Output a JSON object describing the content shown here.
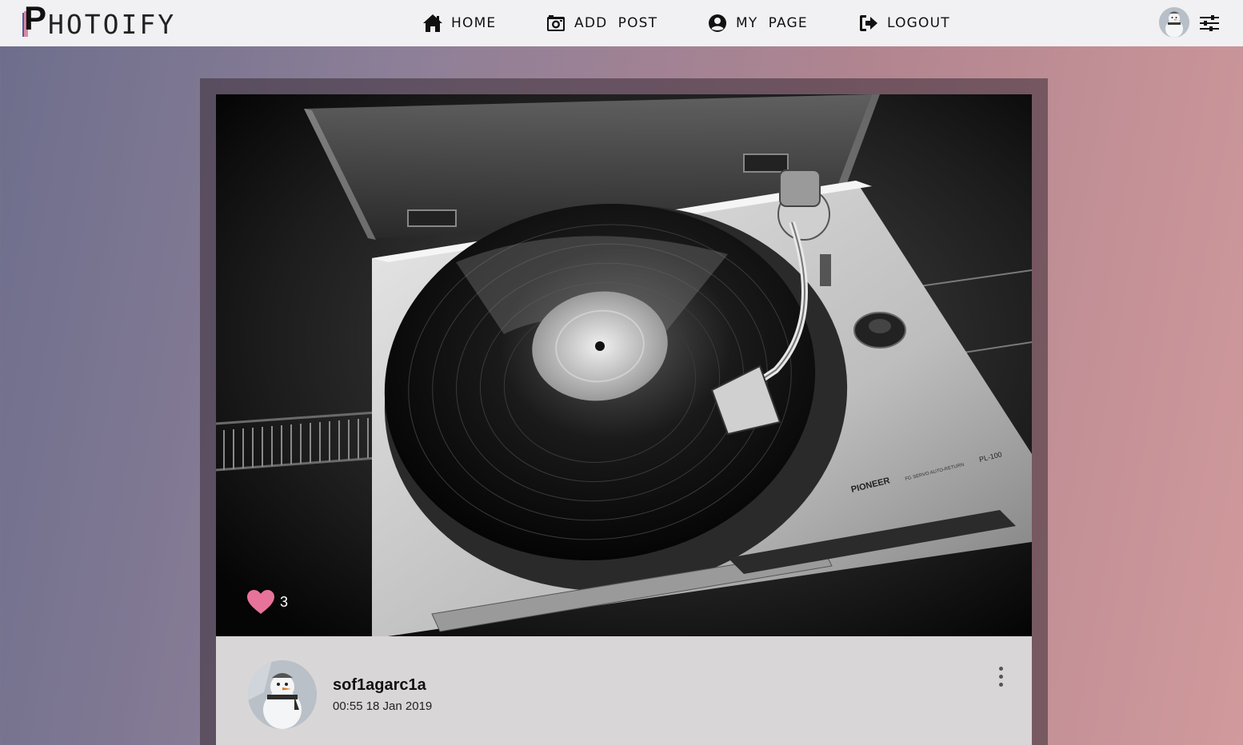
{
  "app": {
    "logo_letter": "P",
    "logo_text": "HOTOIFY"
  },
  "nav": {
    "items": [
      {
        "label": "HOME",
        "icon": "home-icon"
      },
      {
        "label": "ADD  POST",
        "icon": "camera-icon"
      },
      {
        "label": "MY  PAGE",
        "icon": "user-circle-icon"
      },
      {
        "label": "LOGOUT",
        "icon": "sign-out-icon"
      }
    ],
    "avatar_icon": "snowman-avatar",
    "settings_icon": "sliders-icon"
  },
  "post": {
    "image_icon": "turntable-photo",
    "likes": "3",
    "like_color": "#e8739a",
    "author": "sof1agarc1a",
    "timestamp": "00:55 18 Jan 2019",
    "menu_icon": "more-vertical-icon",
    "turntable_label": "PIONEER",
    "turntable_model": "PL-100",
    "turntable_caption": "FG SERVO  AUTO-RETURN"
  },
  "colors": {
    "nav_bg": "#f1f0f2",
    "footer_bg": "#d9d6d8",
    "accent_pink": "#e8739a"
  }
}
